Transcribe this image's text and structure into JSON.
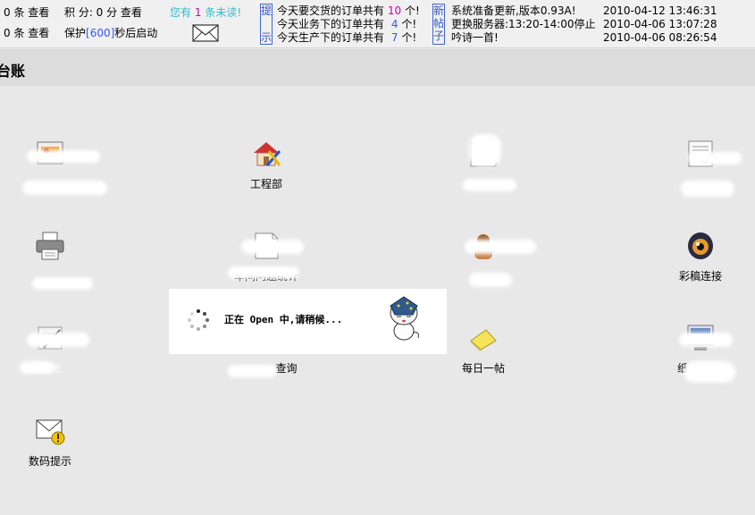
{
  "topbar": {
    "row1_count": "0 条 查看",
    "row1_points": "积  分: 0 分 查看",
    "unread_prefix": "您有",
    "unread_count": "1",
    "unread_suffix": "条未读!",
    "row2_count": "0 条 查看",
    "protect_prefix": "保护",
    "protect_seconds": "[600]",
    "protect_suffix": "秒后启动",
    "tip_box": [
      "提",
      "示"
    ],
    "orders": [
      {
        "prefix": "今天要交货的订单共有",
        "count": "10",
        "suffix": "个!"
      },
      {
        "prefix": "今天业务下的订单共有",
        "count": "4",
        "suffix": "个!"
      },
      {
        "prefix": "今天生产下的订单共有",
        "count": "7",
        "suffix": "个!"
      }
    ],
    "newpost_box": [
      "新",
      "帖",
      "子"
    ],
    "posts": [
      {
        "title": "系统准备更新,版本0.93A!",
        "time": "2010-04-12 13:46:31"
      },
      {
        "title": "更换服务器:13:20-14:00停止",
        "time": "2010-04-06 13:07:28"
      },
      {
        "title": "吟诗一首!",
        "time": "2010-04-06 08:26:54"
      }
    ]
  },
  "page_title": "台账",
  "apps": [
    {
      "label": "",
      "icon": "cards-icon"
    },
    {
      "label": "工程部",
      "icon": "house-tools-icon"
    },
    {
      "label": "",
      "icon": "window-icon"
    },
    {
      "label": "",
      "icon": "document-chart-icon"
    },
    {
      "label": "",
      "icon": "printer-icon"
    },
    {
      "label": "车间问题统计",
      "icon": "page-icon"
    },
    {
      "label": "",
      "icon": "person-icon"
    },
    {
      "label": "彩稿连接",
      "icon": "eye-icon"
    },
    {
      "label": "台账",
      "icon": "pen-paper-icon"
    },
    {
      "label": "查询",
      "icon": "search-doc-icon"
    },
    {
      "label": "每日一帖",
      "icon": "sticky-note-icon"
    },
    {
      "label": "纸",
      "icon": "monitor-icon"
    },
    {
      "label": "数码提示",
      "icon": "envelope-warning-icon"
    }
  ],
  "loading": {
    "text": "正在 Open 中,请稍候..."
  }
}
